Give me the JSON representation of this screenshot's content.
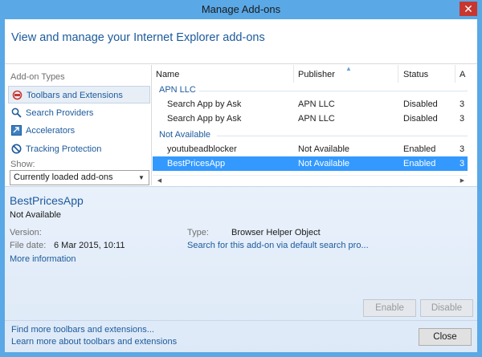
{
  "window": {
    "title": "Manage Add-ons",
    "close_glyph": "✕"
  },
  "header": {
    "text": "View and manage your Internet Explorer add-ons"
  },
  "sidebar": {
    "group_title": "Add-on Types",
    "items": [
      {
        "label": "Toolbars and Extensions",
        "icon": "toolbar-icon"
      },
      {
        "label": "Search Providers",
        "icon": "search-icon"
      },
      {
        "label": "Accelerators",
        "icon": "accelerator-icon"
      },
      {
        "label": "Tracking Protection",
        "icon": "tracking-protection-icon"
      }
    ],
    "show_label": "Show:",
    "show_selected": "Currently loaded add-ons"
  },
  "list": {
    "columns": {
      "name": "Name",
      "publisher": "Publisher",
      "status": "Status",
      "arch": "A"
    },
    "groups": [
      {
        "title": "APN LLC",
        "rows": [
          {
            "name": "Search App by Ask",
            "publisher": "APN LLC",
            "status": "Disabled",
            "arch": "3"
          },
          {
            "name": "Search App by Ask",
            "publisher": "APN LLC",
            "status": "Disabled",
            "arch": "3"
          }
        ]
      },
      {
        "title": "Not Available",
        "rows": [
          {
            "name": "youtubeadblocker",
            "publisher": "Not Available",
            "status": "Enabled",
            "arch": "3"
          },
          {
            "name": "BestPricesApp",
            "publisher": "Not Available",
            "status": "Enabled",
            "arch": "3"
          }
        ]
      }
    ]
  },
  "details": {
    "name": "BestPricesApp",
    "publisher": "Not Available",
    "version_label": "Version:",
    "version_value": "",
    "file_date_label": "File date:",
    "file_date_value": "6 Mar 2015, 10:11",
    "more_info_link": "More information",
    "type_label": "Type:",
    "type_value": "Browser Helper Object",
    "search_link": "Search for this add-on via default search pro...",
    "enable_label": "Enable",
    "disable_label": "Disable"
  },
  "footer": {
    "find_more_link": "Find more toolbars and extensions...",
    "learn_more_link": "Learn more about toolbars and extensions",
    "close_label": "Close"
  },
  "colors": {
    "accent": "#1c5a9c",
    "selection": "#3399ff",
    "titlebar": "#5aa8e6",
    "close": "#c7372f"
  }
}
